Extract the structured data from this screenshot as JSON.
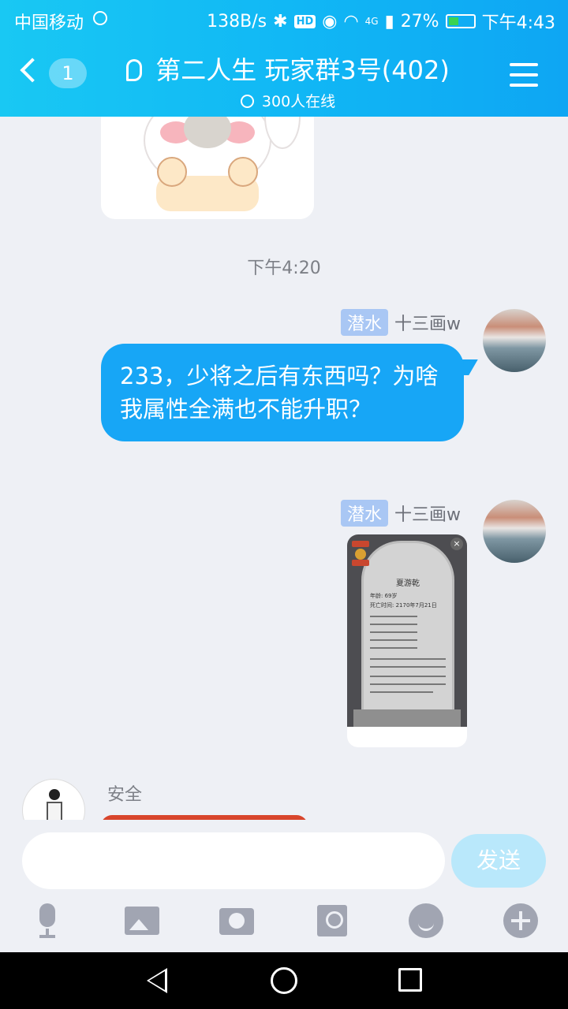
{
  "status_bar": {
    "carrier": "中国移动",
    "net_speed": "138B/s",
    "hd": "HD",
    "network": "4G",
    "battery": "27%",
    "time": "下午4:43"
  },
  "header": {
    "unread_count": "1",
    "group_name": "第二人生 玩家群3号(402)",
    "online_text": "300人在线"
  },
  "chat": {
    "timestamp": "下午4:20",
    "messages": [
      {
        "rank": "潜水",
        "sender": "十三画w",
        "text": "233，少将之后有东西吗？为啥我属性全满也不能升职？"
      },
      {
        "rank": "潜水",
        "sender": "十三画w",
        "image": {
          "name": "夏游乾",
          "age": "年龄: 69岁",
          "death": "死亡时间: 2170年7月21日"
        }
      },
      {
        "sender": "安全"
      }
    ]
  },
  "input": {
    "placeholder": "",
    "send_label": "发送"
  }
}
